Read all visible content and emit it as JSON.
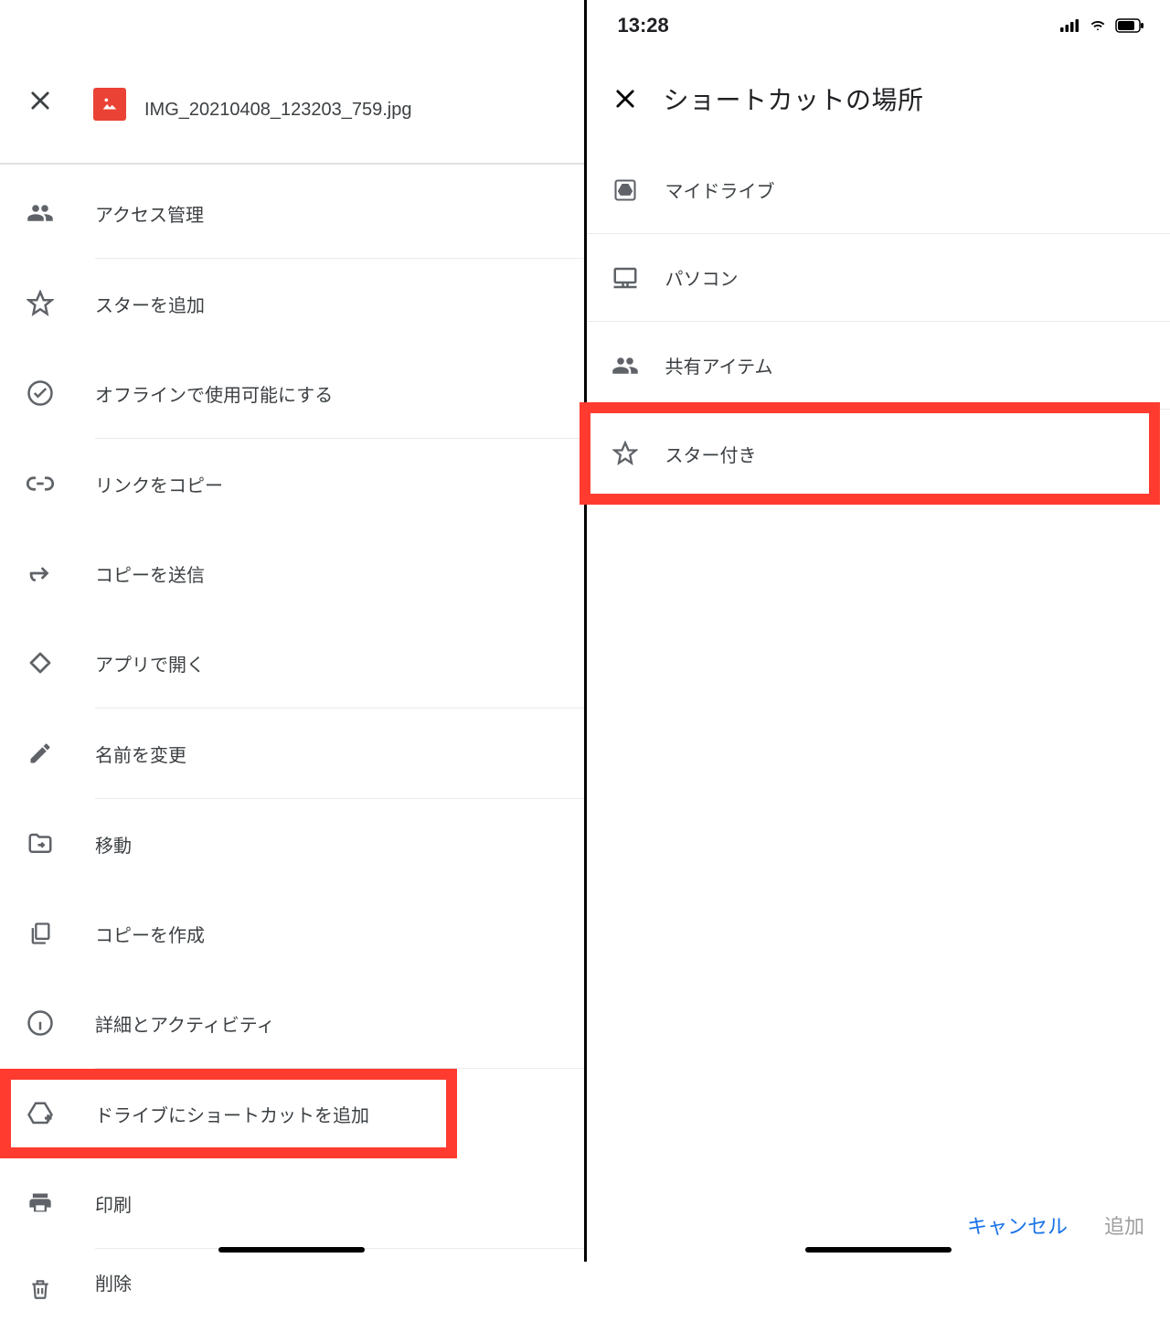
{
  "left": {
    "filename": "IMG_20210408_123203_759.jpg",
    "items": [
      {
        "id": "access",
        "icon": "group-icon",
        "label": "アクセス管理"
      },
      {
        "id": "star",
        "icon": "star-outline-icon",
        "label": "スターを追加"
      },
      {
        "id": "offline",
        "icon": "check-circle-icon",
        "label": "オフラインで使用可能にする"
      },
      {
        "id": "link",
        "icon": "link-icon",
        "label": "リンクをコピー"
      },
      {
        "id": "send",
        "icon": "send-arrow-icon",
        "label": "コピーを送信"
      },
      {
        "id": "openin",
        "icon": "open-in-icon",
        "label": "アプリで開く"
      },
      {
        "id": "rename",
        "icon": "pencil-icon",
        "label": "名前を変更"
      },
      {
        "id": "move",
        "icon": "folder-move-icon",
        "label": "移動"
      },
      {
        "id": "copy",
        "icon": "copy-icon",
        "label": "コピーを作成"
      },
      {
        "id": "details",
        "icon": "info-icon",
        "label": "詳細とアクティビティ"
      },
      {
        "id": "shortcut",
        "icon": "drive-add-icon",
        "label": "ドライブにショートカットを追加",
        "highlight": true
      },
      {
        "id": "print",
        "icon": "print-icon",
        "label": "印刷"
      },
      {
        "id": "delete",
        "icon": "trash-icon",
        "label": "削除"
      }
    ],
    "separators_after": [
      "access",
      "offline",
      "openin",
      "rename",
      "details",
      "print"
    ]
  },
  "right": {
    "status_time": "13:28",
    "title": "ショートカットの場所",
    "items": [
      {
        "id": "mydrive",
        "icon": "drive-icon",
        "label": "マイドライブ"
      },
      {
        "id": "computer",
        "icon": "computer-icon",
        "label": "パソコン"
      },
      {
        "id": "shared",
        "icon": "group-icon",
        "label": "共有アイテム"
      },
      {
        "id": "starred",
        "icon": "star-outline-icon",
        "label": "スター付き",
        "highlight": true
      }
    ],
    "cancel_label": "キャンセル",
    "add_label": "追加"
  }
}
